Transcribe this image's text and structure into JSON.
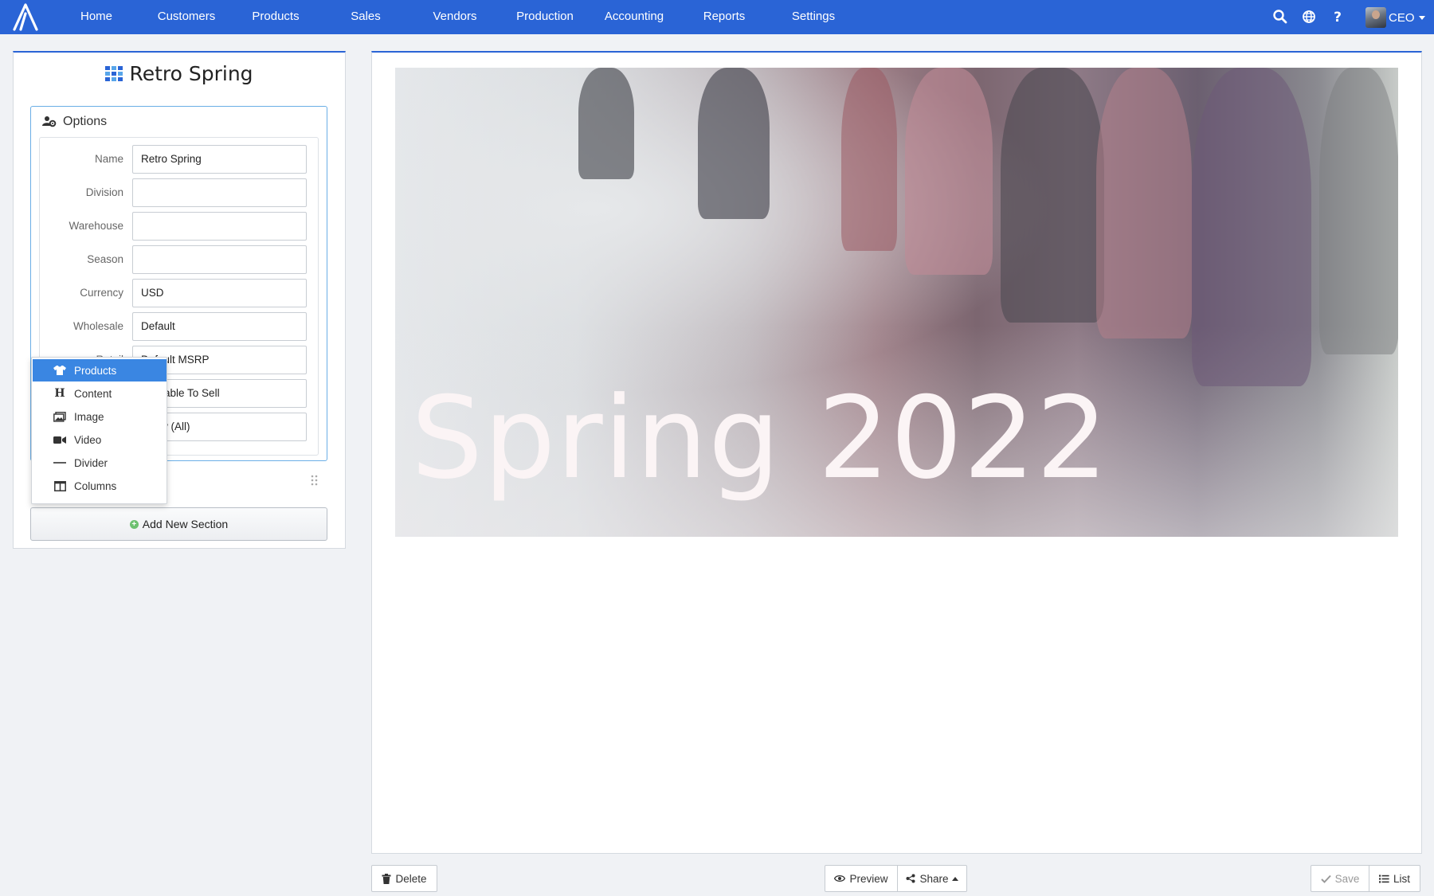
{
  "nav": {
    "items": [
      {
        "label": "Home"
      },
      {
        "label": "Customers"
      },
      {
        "label": "Products"
      },
      {
        "label": "Sales"
      },
      {
        "label": "Vendors"
      },
      {
        "label": "Production"
      },
      {
        "label": "Accounting"
      },
      {
        "label": "Reports"
      },
      {
        "label": "Settings"
      }
    ],
    "user_label": "CEO",
    "icons": [
      "search-icon",
      "globe-icon",
      "help-icon"
    ]
  },
  "panel": {
    "title": "Retro Spring",
    "options_heading": "Options",
    "fields": [
      {
        "label": "Name",
        "value": "Retro Spring"
      },
      {
        "label": "Division",
        "value": ""
      },
      {
        "label": "Warehouse",
        "value": ""
      },
      {
        "label": "Season",
        "value": ""
      },
      {
        "label": "Currency",
        "value": "USD"
      },
      {
        "label": "Wholesale",
        "value": "Default"
      },
      {
        "label": "Retail",
        "value": "Default MSRP"
      },
      {
        "label": "",
        "value": "Available To Sell"
      },
      {
        "label": "",
        "value": "Show (All)"
      }
    ],
    "add_section_label": "Add New Section"
  },
  "section_menu": {
    "items": [
      {
        "label": "Products",
        "icon": "tshirt-icon",
        "active": true
      },
      {
        "label": "Content",
        "icon": "heading-icon",
        "active": false
      },
      {
        "label": "Image",
        "icon": "images-icon",
        "active": false
      },
      {
        "label": "Video",
        "icon": "video-icon",
        "active": false
      },
      {
        "label": "Divider",
        "icon": "divider-icon",
        "active": false
      },
      {
        "label": "Columns",
        "icon": "columns-icon",
        "active": false
      }
    ]
  },
  "preview": {
    "hero_text": "Spring 2022"
  },
  "footer": {
    "delete_label": "Delete",
    "preview_label": "Preview",
    "share_label": "Share",
    "save_label": "Save",
    "list_label": "List"
  },
  "colors": {
    "nav_bg": "#2a64d6",
    "accent": "#3a86e2",
    "options_border": "#6aaee6"
  }
}
